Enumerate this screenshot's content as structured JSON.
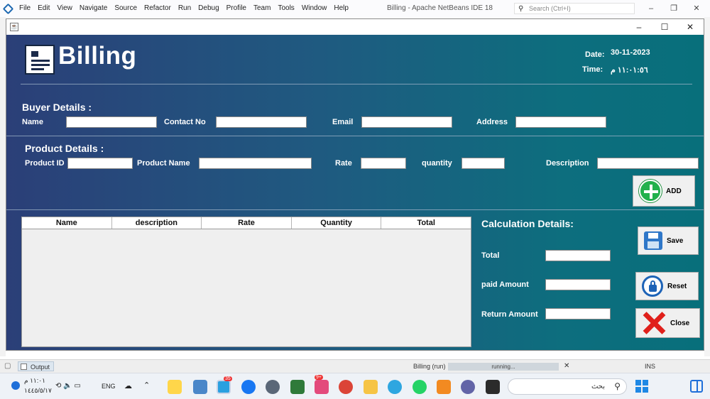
{
  "ide": {
    "menu": [
      "File",
      "Edit",
      "View",
      "Navigate",
      "Source",
      "Refactor",
      "Run",
      "Debug",
      "Profile",
      "Team",
      "Tools",
      "Window",
      "Help"
    ],
    "title": "Billing - Apache NetBeans IDE 18",
    "search_placeholder": "Search (Ctrl+I)",
    "search_icon": "magnifier-icon"
  },
  "window": {
    "icon": "java-window-icon",
    "minimize": "–",
    "maximize": "☐",
    "close": "✕"
  },
  "header": {
    "logo_icon": "receipt-icon",
    "title": "Billing",
    "date_label": "Date:",
    "date_value": "30-11-2023",
    "time_label": "Time:",
    "time_value": "١١:٠١:٥٦ م"
  },
  "buyer": {
    "section_title": "Buyer Details :",
    "name_label": "Name",
    "contact_label": "Contact No",
    "email_label": "Email",
    "address_label": "Address",
    "name_value": "",
    "contact_value": "",
    "email_value": "",
    "address_value": ""
  },
  "product": {
    "section_title": "Product Details :",
    "id_label": "Product ID",
    "name_label": "Product Name",
    "rate_label": "Rate",
    "quantity_label": "quantity",
    "description_label": "Description",
    "add_label": "ADD",
    "add_icon": "plus-circle-icon"
  },
  "table": {
    "columns": [
      "Name",
      "description",
      "Rate",
      "Quantity",
      "Total"
    ],
    "rows": []
  },
  "calc": {
    "title": "Calculation  Details:",
    "total_label": "Total",
    "paid_label": "paid Amount",
    "return_label": "Return Amount",
    "total_value": "",
    "paid_value": "",
    "return_value": ""
  },
  "actions": {
    "save_label": "Save",
    "reset_label": "Reset",
    "close_label": "Close",
    "save_icon": "floppy-disk-icon",
    "reset_icon": "lock-refresh-icon",
    "close_icon": "red-x-icon"
  },
  "status": {
    "output_tab": "Output",
    "run_label": "Billing (run)",
    "progress_text": "running...",
    "cancel": "✕",
    "mode": "INS"
  },
  "taskbar": {
    "clock_time": "١١:٠١ م",
    "clock_date": "١٤٤٥/٥/١٧",
    "language": "ENG",
    "search_text": "بحث",
    "search_icon": "search-icon",
    "notification_badge": "35",
    "other_badge": "9+"
  },
  "colors": {
    "panel_start": "#2b3f78",
    "panel_end": "#086f7b",
    "add_green": "#22b14c",
    "close_red": "#e0201b",
    "save_blue": "#2f77c8"
  }
}
